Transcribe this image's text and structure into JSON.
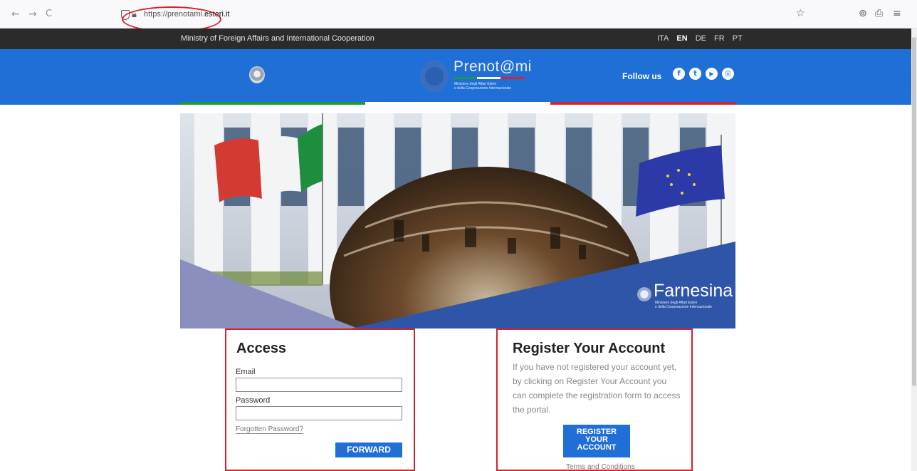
{
  "browser": {
    "back_icon": "←",
    "forward_icon": "→",
    "reload_icon": "C",
    "url_prefix": "https://prenotami.",
    "url_domain": "esteri.it",
    "star_icon": "☆",
    "pocket_icon": "⊚",
    "share_icon": "⎙",
    "menu_icon": "≡"
  },
  "topbar": {
    "ministry": "Ministry of Foreign Affairs and International Cooperation",
    "languages": [
      "ITA",
      "EN",
      "DE",
      "FR",
      "PT"
    ],
    "active_language": "EN"
  },
  "header": {
    "logo_title": "Prenot@mi",
    "logo_subtitle_1": "Ministero degli Affari Esteri",
    "logo_subtitle_2": "e della Cooperazione Internazionale",
    "follow_us": "Follow us",
    "social": [
      "f",
      "t",
      "▶",
      "◎"
    ]
  },
  "hero": {
    "brand": "Farnesina",
    "brand_sub_1": "Ministero degli Affari Esteri",
    "brand_sub_2": "e della Cooperazione Internazionale"
  },
  "access": {
    "title": "Access",
    "email_label": "Email",
    "password_label": "Password",
    "forgot_label": "Forgotten Password?",
    "forward_label": "FORWARD"
  },
  "register": {
    "title": "Register Your Account",
    "text": "If you have not registered your account yet, by clicking on Register Your Account you can complete the registration form to access the portal.",
    "button_label": "REGISTER\nYOUR\nACCOUNT",
    "terms_label": "Terms and Conditions"
  },
  "colors": {
    "brand_blue": "#1f6fd6",
    "dark_bar": "#2b2b2b",
    "highlight_red": "#d6202c",
    "italy_green": "#1e9a3e",
    "italy_red": "#d32632"
  }
}
